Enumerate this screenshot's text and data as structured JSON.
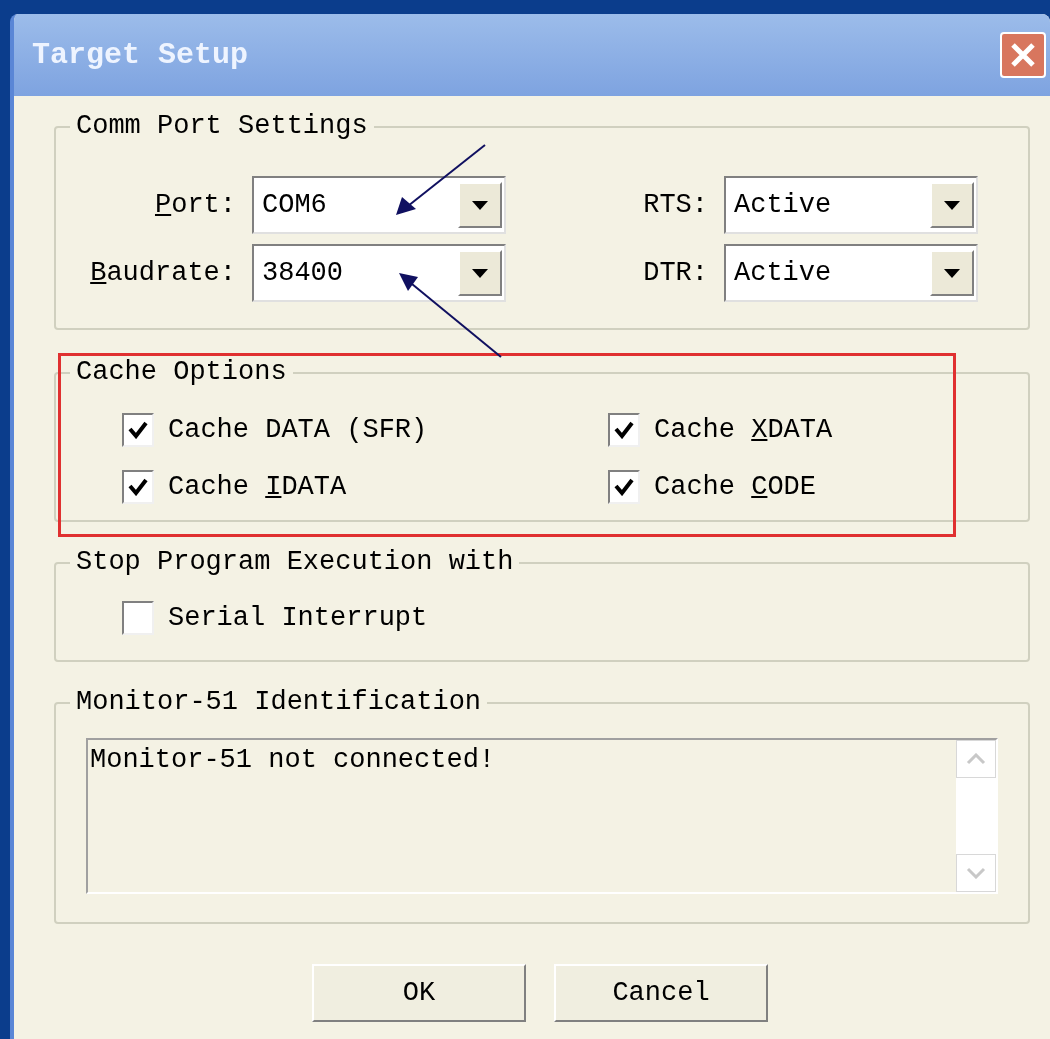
{
  "window": {
    "title": "Target Setup"
  },
  "comm_port_settings": {
    "title": "Comm Port Settings",
    "fields": [
      {
        "label": [
          {
            "text": "P",
            "underlined": true
          },
          {
            "text": "ort:"
          }
        ],
        "value": "COM6"
      },
      {
        "label": [
          {
            "text": "RTS:"
          }
        ],
        "value": "Active"
      },
      {
        "label": [
          {
            "text": "B",
            "underlined": true
          },
          {
            "text": "audrate:"
          }
        ],
        "value": "38400"
      },
      {
        "label": [
          {
            "text": "DTR:"
          }
        ],
        "value": "Active"
      }
    ]
  },
  "cache_options": {
    "title": "Cache Options",
    "items": [
      {
        "label": [
          {
            "text": "Cache DATA (SFR)"
          }
        ],
        "checked": true
      },
      {
        "label": [
          {
            "text": "Cache "
          },
          {
            "text": "X",
            "underlined": true
          },
          {
            "text": "DATA"
          }
        ],
        "checked": true
      },
      {
        "label": [
          {
            "text": "Cache "
          },
          {
            "text": "I",
            "underlined": true
          },
          {
            "text": "DATA"
          }
        ],
        "checked": true
      },
      {
        "label": [
          {
            "text": "Cache "
          },
          {
            "text": "C",
            "underlined": true
          },
          {
            "text": "ODE"
          }
        ],
        "checked": true
      }
    ]
  },
  "stop_program_execution": {
    "title": "Stop Program Execution with",
    "items": [
      {
        "label": [
          {
            "text": "Serial Interrupt"
          }
        ],
        "checked": false
      }
    ]
  },
  "monitor_identification": {
    "title": "Monitor-51 Identification",
    "text": "Monitor-51 not connected!"
  },
  "buttons": [
    "OK",
    "Cancel"
  ]
}
